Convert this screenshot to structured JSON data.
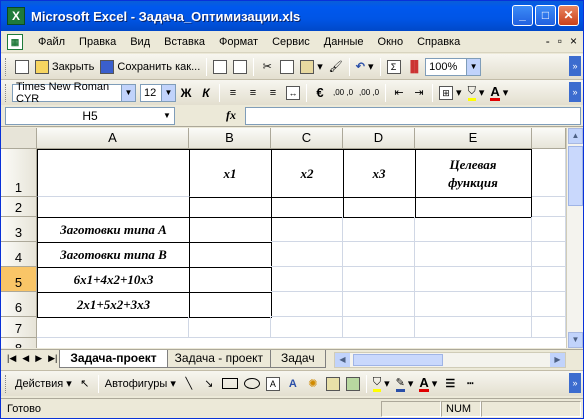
{
  "window": {
    "title": "Microsoft Excel - Задача_Оптимизации.xls",
    "app_icon": "X"
  },
  "title_buttons": {
    "minimize": "_",
    "maximize": "□",
    "close": "✕"
  },
  "menu": {
    "items": [
      "Файл",
      "Правка",
      "Вид",
      "Вставка",
      "Формат",
      "Сервис",
      "Данные",
      "Окно",
      "Справка"
    ],
    "right": [
      "-",
      "▫",
      "×"
    ]
  },
  "standard_toolbar": {
    "close_label": "Закрыть",
    "save_as_label": "Сохранить как...",
    "zoom": "100%"
  },
  "format_toolbar": {
    "font": "Times New Roman CYR",
    "size": "12",
    "bold": "Ж",
    "italic": "К",
    "euro": "€",
    "inc_dec": ",00 ,0",
    "dec_dec": ",00 ,0"
  },
  "formula_bar": {
    "name_box": "H5",
    "fx": "fx",
    "content": ""
  },
  "columns": [
    "A",
    "B",
    "C",
    "D",
    "E"
  ],
  "rows": [
    "1",
    "2",
    "3",
    "4",
    "5",
    "6",
    "7",
    "8"
  ],
  "active_cell": {
    "column": "",
    "row": "5"
  },
  "cells": {
    "B1": "x1",
    "C1": "x2",
    "D1": "x3",
    "E1": "Целевая функция",
    "A3": "Заготовки типа А",
    "A4": "Заготовки типа В",
    "A5": "6x1+4x2+10x3",
    "A6": "2x1+5x2+3x3"
  },
  "sheet_tabs": [
    "Задача-проект",
    "Задача - проект",
    "Задач"
  ],
  "active_tab": "Задача-проект",
  "drawing_toolbar": {
    "actions_label": "Действия",
    "autoshapes_label": "Автофигуры"
  },
  "status": {
    "text": "Готово",
    "num": "NUM"
  }
}
